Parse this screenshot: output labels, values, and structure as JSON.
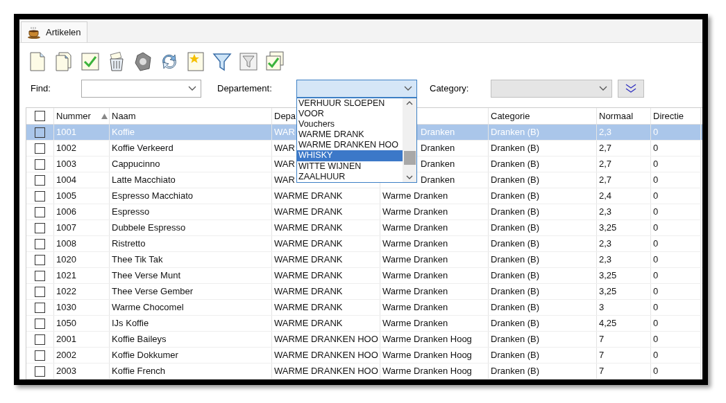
{
  "tab": {
    "label": "Artikelen",
    "selected": true
  },
  "filters": {
    "find": {
      "label": "Find:"
    },
    "departement": {
      "label": "Departement:",
      "expanded": true,
      "options": [
        {
          "label": "VERHUUR SLOEPEN",
          "selected": false
        },
        {
          "label": "VOOR",
          "selected": false
        },
        {
          "label": "Vouchers",
          "selected": false
        },
        {
          "label": "WARME DRANK",
          "selected": false
        },
        {
          "label": "WARME DRANKEN HOO",
          "selected": false
        },
        {
          "label": "WHISKY",
          "selected": true
        },
        {
          "label": "WITTE WIJNEN",
          "selected": false
        },
        {
          "label": "ZAALHUUR",
          "selected": false
        }
      ]
    },
    "category": {
      "label": "Category:",
      "disabled": true
    }
  },
  "table": {
    "all_checked": false,
    "columns": [
      {
        "label": "Nummer",
        "sorted": true
      },
      {
        "label": "Naam",
        "sorted": false
      },
      {
        "label": "Depa",
        "sorted": false
      },
      {},
      {
        "label": "Categorie",
        "sorted": false
      },
      {
        "label": "Normaal",
        "sorted": false
      },
      {
        "label": "Directie",
        "sorted": false
      }
    ],
    "rows": [
      {
        "selected": true,
        "checked": false,
        "cells": [
          "1001",
          "Koffie",
          "WAR",
          {
            "text": "Dranken",
            "kind": "partial"
          },
          "Dranken (B)",
          "2,3",
          "0"
        ]
      },
      {
        "selected": false,
        "checked": false,
        "cells": [
          "1002",
          "Koffie Verkeerd",
          "WAR",
          {
            "text": "Dranken",
            "kind": "partial"
          },
          "Dranken (B)",
          "2,7",
          "0"
        ]
      },
      {
        "selected": false,
        "checked": false,
        "cells": [
          "1003",
          "Cappucinno",
          "WAR",
          {
            "text": "Dranken",
            "kind": "partial"
          },
          "Dranken (B)",
          "2,7",
          "0"
        ]
      },
      {
        "selected": false,
        "checked": false,
        "cells": [
          "1004",
          "Latte Macchiato",
          "WAR",
          {
            "text": "Dranken",
            "kind": "partial"
          },
          "Dranken (B)",
          "2,7",
          "0"
        ]
      },
      {
        "selected": false,
        "checked": false,
        "cells": [
          "1005",
          "Espresso Macchiato",
          "WARME DRANK",
          "Warme Dranken",
          "Dranken (B)",
          "2,4",
          "0"
        ]
      },
      {
        "selected": false,
        "checked": false,
        "cells": [
          "1006",
          "Espresso",
          "WARME DRANK",
          "Warme Dranken",
          "Dranken (B)",
          "2,3",
          "0"
        ]
      },
      {
        "selected": false,
        "checked": false,
        "cells": [
          "1007",
          "Dubbele Espresso",
          "WARME DRANK",
          "Warme Dranken",
          "Dranken (B)",
          "3,25",
          "0"
        ]
      },
      {
        "selected": false,
        "checked": false,
        "cells": [
          "1008",
          "Ristretto",
          "WARME DRANK",
          "Warme Dranken",
          "Dranken (B)",
          "2,3",
          "0"
        ]
      },
      {
        "selected": false,
        "checked": false,
        "cells": [
          "1020",
          "Thee Tik Tak",
          "WARME DRANK",
          "Warme Dranken",
          "Dranken (B)",
          "2,3",
          "0"
        ]
      },
      {
        "selected": false,
        "checked": false,
        "cells": [
          "1021",
          "Thee Verse Munt",
          "WARME DRANK",
          "Warme Dranken",
          "Dranken (B)",
          "3,25",
          "0"
        ]
      },
      {
        "selected": false,
        "checked": false,
        "cells": [
          "1022",
          "Thee Verse Gember",
          "WARME DRANK",
          "Warme Dranken",
          "Dranken (B)",
          "3,25",
          "0"
        ]
      },
      {
        "selected": false,
        "checked": false,
        "cells": [
          "1030",
          "Warme Chocomel",
          "WARME DRANK",
          "Warme Dranken",
          "Dranken (B)",
          "3",
          "0"
        ]
      },
      {
        "selected": false,
        "checked": false,
        "cells": [
          "1050",
          "IJs Koffie",
          "WARME DRANK",
          "Warme Dranken",
          "Dranken (B)",
          "4,25",
          "0"
        ]
      },
      {
        "selected": false,
        "checked": false,
        "cells": [
          "2001",
          "Koffie Baileys",
          "WARME DRANKEN HOO",
          "Warme Dranken Hoog",
          "Dranken (B)",
          "7",
          "0"
        ]
      },
      {
        "selected": false,
        "checked": false,
        "cells": [
          "2002",
          "Koffie Dokkumer",
          "WARME DRANKEN HOO",
          "Warme Dranken Hoog",
          "Dranken (B)",
          "7",
          "0"
        ]
      },
      {
        "selected": false,
        "checked": false,
        "cells": [
          "2003",
          "Koffie French",
          "WARME DRANKEN HOO",
          "Warme Dranken Hoog",
          "Dranken (B)",
          "7",
          "0"
        ]
      }
    ]
  }
}
